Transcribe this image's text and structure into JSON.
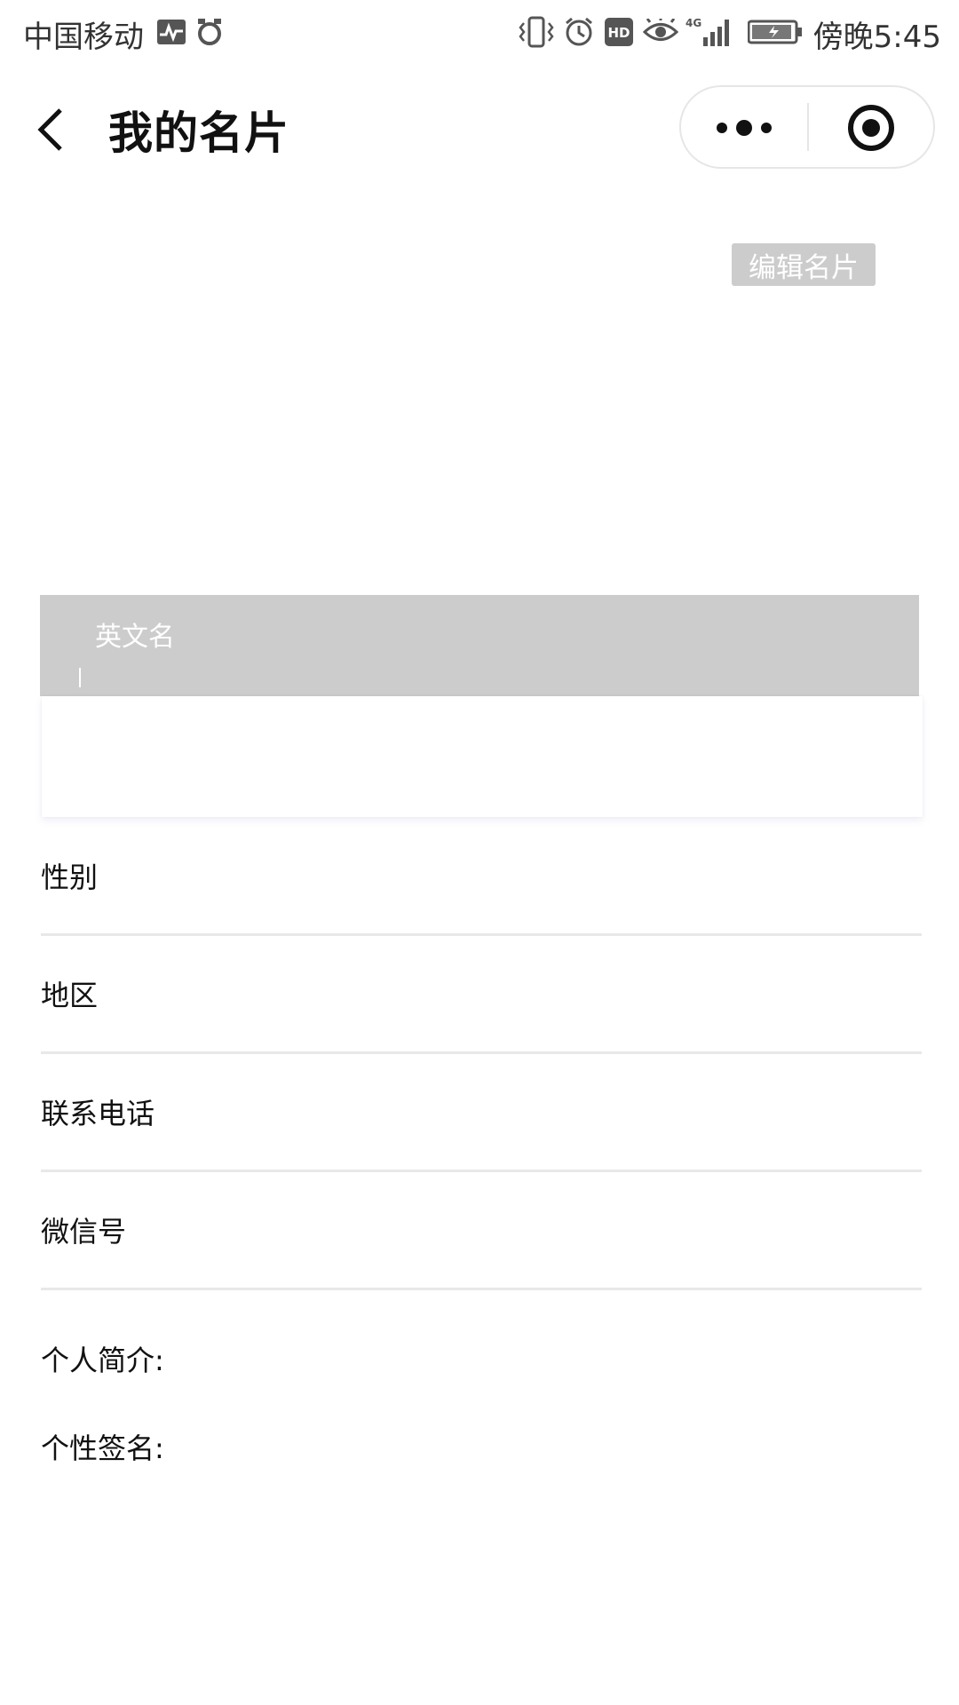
{
  "status_bar": {
    "carrier": "中国移动",
    "time": "傍晚5:45",
    "icons": [
      "activity-icon",
      "alarm-clock-icon",
      "vibrate-icon",
      "alarm-icon",
      "hd-icon",
      "eye-icon",
      "signal-4g-icon",
      "battery-icon"
    ]
  },
  "nav": {
    "title": "我的名片",
    "more_icon": "ellipsis-icon",
    "close_icon": "target-icon"
  },
  "card": {
    "edit_button": "编辑名片",
    "english_name_label": "英文名"
  },
  "fields": [
    {
      "label": "性别"
    },
    {
      "label": "地区"
    },
    {
      "label": "联系电话"
    },
    {
      "label": "微信号"
    }
  ],
  "profile": {
    "intro_label": "个人简介:",
    "signature_label": "个性签名:"
  },
  "colors": {
    "placeholder_gray": "#cccccc",
    "divider": "#e8e8e8",
    "text": "#111111"
  }
}
